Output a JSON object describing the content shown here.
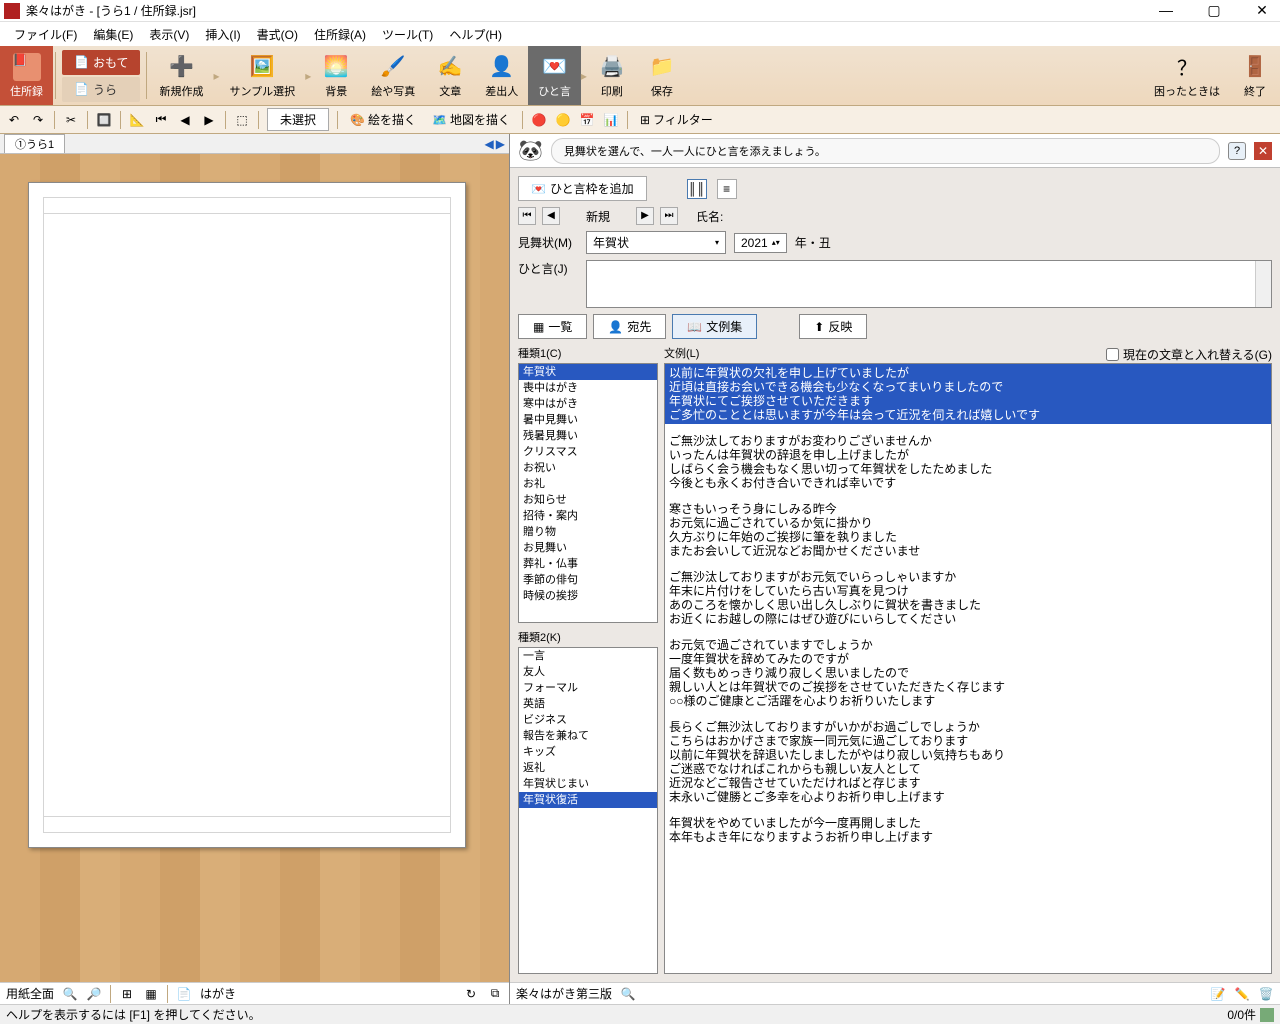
{
  "title": "楽々はがき - [うら1 / 住所録.jsr]",
  "menu": [
    "ファイル(F)",
    "編集(E)",
    "表示(V)",
    "挿入(I)",
    "書式(O)",
    "住所録(A)",
    "ツール(T)",
    "ヘルプ(H)"
  ],
  "ribbon": {
    "addressbook": "住所録",
    "omote": "おもて",
    "ura": "うら",
    "new": "新規作成",
    "sample": "サンプル選択",
    "background": "背景",
    "picture": "絵や写真",
    "text": "文章",
    "sender": "差出人",
    "hitokoto": "ひと言",
    "print": "印刷",
    "save": "保存",
    "help": "困ったときは",
    "exit": "終了"
  },
  "toolbar": {
    "unselected": "未選択",
    "draw": "絵を描く",
    "map": "地図を描く",
    "filter": "フィルター"
  },
  "leftTab": "①うら1",
  "speech": "見舞状を選んで、一人一人にひと言を添えましょう。",
  "panel": {
    "add_frame": "ひと言枠を追加",
    "new": "新規",
    "name_label": "氏名:",
    "mimai_label": "見舞状(M)",
    "mimai_value": "年賀状",
    "year": "2021",
    "year_suffix": "年・丑",
    "hitokoto_label": "ひと言(J)",
    "tab_list": "一覧",
    "tab_dest": "宛先",
    "tab_examples": "文例集",
    "reflect": "反映",
    "type1_label": "種類1(C)",
    "type2_label": "種類2(K)",
    "example_label": "文例(L)",
    "replace_check": "現在の文章と入れ替える(G)"
  },
  "type1": [
    "年賀状",
    "喪中はがき",
    "寒中はがき",
    "暑中見舞い",
    "残暑見舞い",
    "クリスマス",
    "お祝い",
    "お礼",
    "お知らせ",
    "招待・案内",
    "贈り物",
    "お見舞い",
    "葬礼・仏事",
    "季節の俳句",
    "時候の挨拶"
  ],
  "type1_sel": 0,
  "type2": [
    "一言",
    "友人",
    "フォーマル",
    "英語",
    "ビジネス",
    "報告を兼ねて",
    "キッズ",
    "返礼",
    "年賀状じまい",
    "年賀状復活"
  ],
  "type2_sel": 9,
  "examples": [
    {
      "sel": true,
      "lines": [
        "以前に年賀状の欠礼を申し上げていましたが",
        "近頃は直接お会いできる機会も少なくなってまいりましたので",
        "年賀状にてご挨拶させていただきます",
        "ご多忙のこととは思いますが今年は会って近況を伺えれば嬉しいです"
      ]
    },
    {
      "lines": [
        "ご無沙汰しておりますがお変わりございませんか",
        "いったんは年賀状の辞退を申し上げましたが",
        "しばらく会う機会もなく思い切って年賀状をしたためました",
        "今後とも永くお付き合いできれば幸いです"
      ]
    },
    {
      "lines": [
        "寒さもいっそう身にしみる昨今",
        "お元気に過ごされているか気に掛かり",
        "久方ぶりに年始のご挨拶に筆を執りました",
        "またお会いして近況などお聞かせくださいませ"
      ]
    },
    {
      "lines": [
        "ご無沙汰しておりますがお元気でいらっしゃいますか",
        "年末に片付けをしていたら古い写真を見つけ",
        "あのころを懐かしく思い出し久しぶりに賀状を書きました",
        "お近くにお越しの際にはぜひ遊びにいらしてください"
      ]
    },
    {
      "lines": [
        "お元気で過ごされていますでしょうか",
        "一度年賀状を辞めてみたのですが",
        "届く数もめっきり減り寂しく思いましたので",
        "親しい人とは年賀状でのご挨拶をさせていただきたく存じます",
        "○○様のご健康とご活躍を心よりお祈りいたします"
      ]
    },
    {
      "lines": [
        "長らくご無沙汰しておりますがいかがお過ごしでしょうか",
        "こちらはおかげさまで家族一同元気に過ごしております",
        "以前に年賀状を辞退いたしましたがやはり寂しい気持ちもあり",
        "ご迷惑でなければこれからも親しい友人として",
        "近況などご報告させていただければと存じます",
        "末永いご健勝とご多幸を心よりお祈り申し上げます"
      ]
    },
    {
      "lines": [
        "年賀状をやめていましたが今一度再開しました",
        "本年もよき年になりますようお祈り申し上げます"
      ]
    }
  ],
  "status_left": {
    "paper": "用紙全面",
    "hagaki": "はがき"
  },
  "status_right": {
    "edition": "楽々はがき第三版",
    "count": "0/0件"
  },
  "bottom_help": "ヘルプを表示するには [F1] を押してください。"
}
